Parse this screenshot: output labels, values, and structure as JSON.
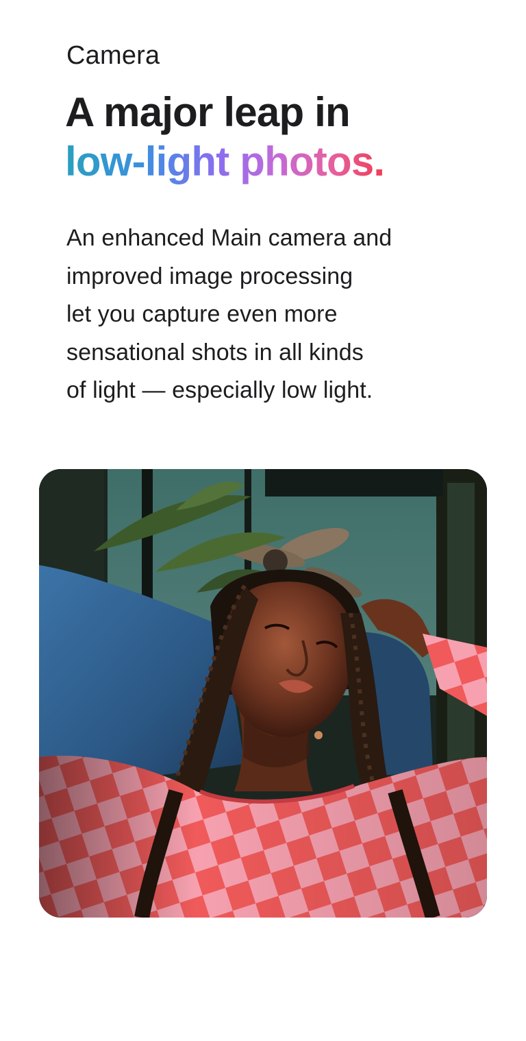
{
  "section": {
    "eyebrow": "Camera",
    "headline_line1": "A major leap in",
    "headline_line2": "low-light photos.",
    "body_lines": [
      "An enhanced Main camera and",
      "improved image processing",
      "let you capture even more",
      "sensational shots in all kinds",
      "of light — especially low light."
    ]
  },
  "colors": {
    "text": "#1d1d1f",
    "gradient_start": "#2a9fbf",
    "gradient_mid": "#8a6ef0",
    "gradient_end": "#ef3d55"
  }
}
